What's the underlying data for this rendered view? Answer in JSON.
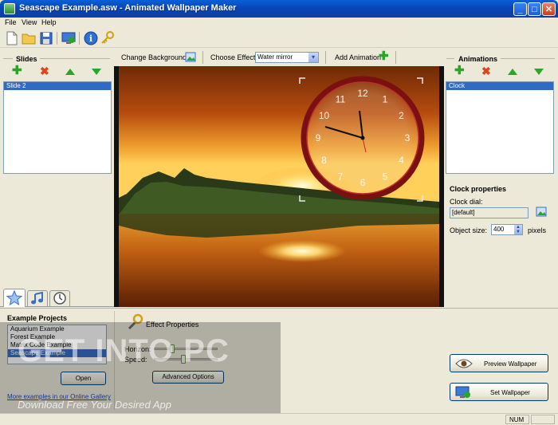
{
  "window": {
    "title": "Seascape Example.asw - Animated Wallpaper Maker"
  },
  "menu": [
    "File",
    "View",
    "Help"
  ],
  "effect_bar": {
    "change_background": "Change Background",
    "choose_effect_label": "Choose Effect:",
    "effect_value": "Water mirror",
    "add_animation": "Add Animation"
  },
  "slides": {
    "title": "Slides",
    "items": [
      "Slide 2"
    ]
  },
  "animations": {
    "title": "Animations",
    "items": [
      "Clock"
    ]
  },
  "clock_properties": {
    "title": "Clock properties",
    "dial_label": "Clock dial:",
    "dial_value": "[default]",
    "size_label": "Object size:",
    "size_value": "400",
    "size_unit": "pixels"
  },
  "clock_numbers": [
    "12",
    "1",
    "2",
    "3",
    "4",
    "5",
    "6",
    "7",
    "8",
    "9",
    "10",
    "11"
  ],
  "examples": {
    "title": "Example Projects",
    "items": [
      "Aquarium Example",
      "Forest Example",
      "Matrix Code Example",
      "Seascape Example"
    ],
    "selected_index": 3,
    "open_button": "Open",
    "more_link": "More examples in our Online Gallery"
  },
  "effect_properties": {
    "title": "Effect Properties",
    "horizon_label": "Horizon:",
    "speed_label": "Speed:",
    "horizon_level": 0.25,
    "speed_level": 0.45,
    "advanced_button": "Advanced Options"
  },
  "actions": {
    "preview": "Preview Wallpaper",
    "set": "Set Wallpaper"
  },
  "watermark": {
    "main": "GET INTO PC",
    "sub": "Download Free Your Desired App"
  },
  "status": {
    "num": "NUM"
  },
  "colors": {
    "accent_blue": "#316ac5",
    "title_blue": "#0846b8",
    "clock_rim": "#8a1414"
  }
}
